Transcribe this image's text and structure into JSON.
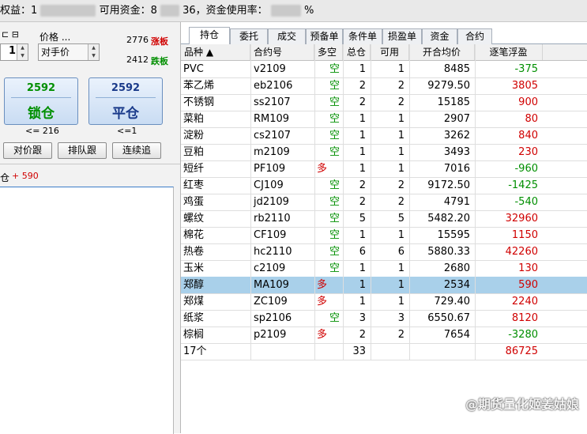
{
  "topbar": {
    "equity_label": "权益：1",
    "available_label": "可用资金：8",
    "available_tail": "36，资金使用率：",
    "percent_tail": "%"
  },
  "order_panel": {
    "price_label": "价格 ...",
    "qty_value": "1",
    "price_value": "对手价",
    "limit_up_value": "2776",
    "limit_up_label": "涨板",
    "limit_down_value": "2412",
    "limit_down_label": "跌板",
    "lock_button": {
      "price": "2592",
      "label": "锁仓",
      "note": "<= 216"
    },
    "close_button": {
      "price": "2592",
      "label": "平仓",
      "note": "<=1"
    },
    "follow_counter": "对价跟",
    "follow_queue": "排队跟",
    "continuous_chase": "连续追",
    "position_note": "仓",
    "position_profit": "+ 590"
  },
  "tabs": [
    "持仓",
    "委托",
    "成交",
    "预备单",
    "条件单",
    "损盈单",
    "资金",
    "合约"
  ],
  "columns": [
    "品种 ▲",
    "合约号",
    "多空",
    "总仓",
    "可用",
    "开合均价",
    "逐笔浮盈"
  ],
  "rows": [
    {
      "name": "PVC",
      "contract": "v2109",
      "dir": "空",
      "total": "1",
      "avail": "1",
      "price": "8485",
      "pnl": "-375"
    },
    {
      "name": "苯乙烯",
      "contract": "eb2106",
      "dir": "空",
      "total": "2",
      "avail": "2",
      "price": "9279.50",
      "pnl": "3805"
    },
    {
      "name": "不锈钢",
      "contract": "ss2107",
      "dir": "空",
      "total": "2",
      "avail": "2",
      "price": "15185",
      "pnl": "900"
    },
    {
      "name": "菜粕",
      "contract": "RM109",
      "dir": "空",
      "total": "1",
      "avail": "1",
      "price": "2907",
      "pnl": "80"
    },
    {
      "name": "淀粉",
      "contract": "cs2107",
      "dir": "空",
      "total": "1",
      "avail": "1",
      "price": "3262",
      "pnl": "840"
    },
    {
      "name": "豆粕",
      "contract": "m2109",
      "dir": "空",
      "total": "1",
      "avail": "1",
      "price": "3493",
      "pnl": "230"
    },
    {
      "name": "短纤",
      "contract": "PF109",
      "dir": "多",
      "total": "1",
      "avail": "1",
      "price": "7016",
      "pnl": "-960"
    },
    {
      "name": "红枣",
      "contract": "CJ109",
      "dir": "空",
      "total": "2",
      "avail": "2",
      "price": "9172.50",
      "pnl": "-1425"
    },
    {
      "name": "鸡蛋",
      "contract": "jd2109",
      "dir": "空",
      "total": "2",
      "avail": "2",
      "price": "4791",
      "pnl": "-540"
    },
    {
      "name": "螺纹",
      "contract": "rb2110",
      "dir": "空",
      "total": "5",
      "avail": "5",
      "price": "5482.20",
      "pnl": "32960"
    },
    {
      "name": "棉花",
      "contract": "CF109",
      "dir": "空",
      "total": "1",
      "avail": "1",
      "price": "15595",
      "pnl": "1150"
    },
    {
      "name": "热卷",
      "contract": "hc2110",
      "dir": "空",
      "total": "6",
      "avail": "6",
      "price": "5880.33",
      "pnl": "42260"
    },
    {
      "name": "玉米",
      "contract": "c2109",
      "dir": "空",
      "total": "1",
      "avail": "1",
      "price": "2680",
      "pnl": "130"
    },
    {
      "name": "郑醇",
      "contract": "MA109",
      "dir": "多",
      "total": "1",
      "avail": "1",
      "price": "2534",
      "pnl": "590"
    },
    {
      "name": "郑煤",
      "contract": "ZC109",
      "dir": "多",
      "total": "1",
      "avail": "1",
      "price": "729.40",
      "pnl": "2240"
    },
    {
      "name": "纸浆",
      "contract": "sp2106",
      "dir": "空",
      "total": "3",
      "avail": "3",
      "price": "6550.67",
      "pnl": "8120"
    },
    {
      "name": "棕榈",
      "contract": "p2109",
      "dir": "多",
      "total": "2",
      "avail": "2",
      "price": "7654",
      "pnl": "-3280"
    }
  ],
  "summary": {
    "count": "17个",
    "total": "33",
    "pnl": "86725"
  },
  "selected_row": 13,
  "colors": {
    "profit": "#d00000",
    "loss": "#008f00",
    "long": "#d00000",
    "short": "#008f00",
    "selected": "#a9d0ea"
  },
  "watermark": "@期货量化姬姜姑娘"
}
